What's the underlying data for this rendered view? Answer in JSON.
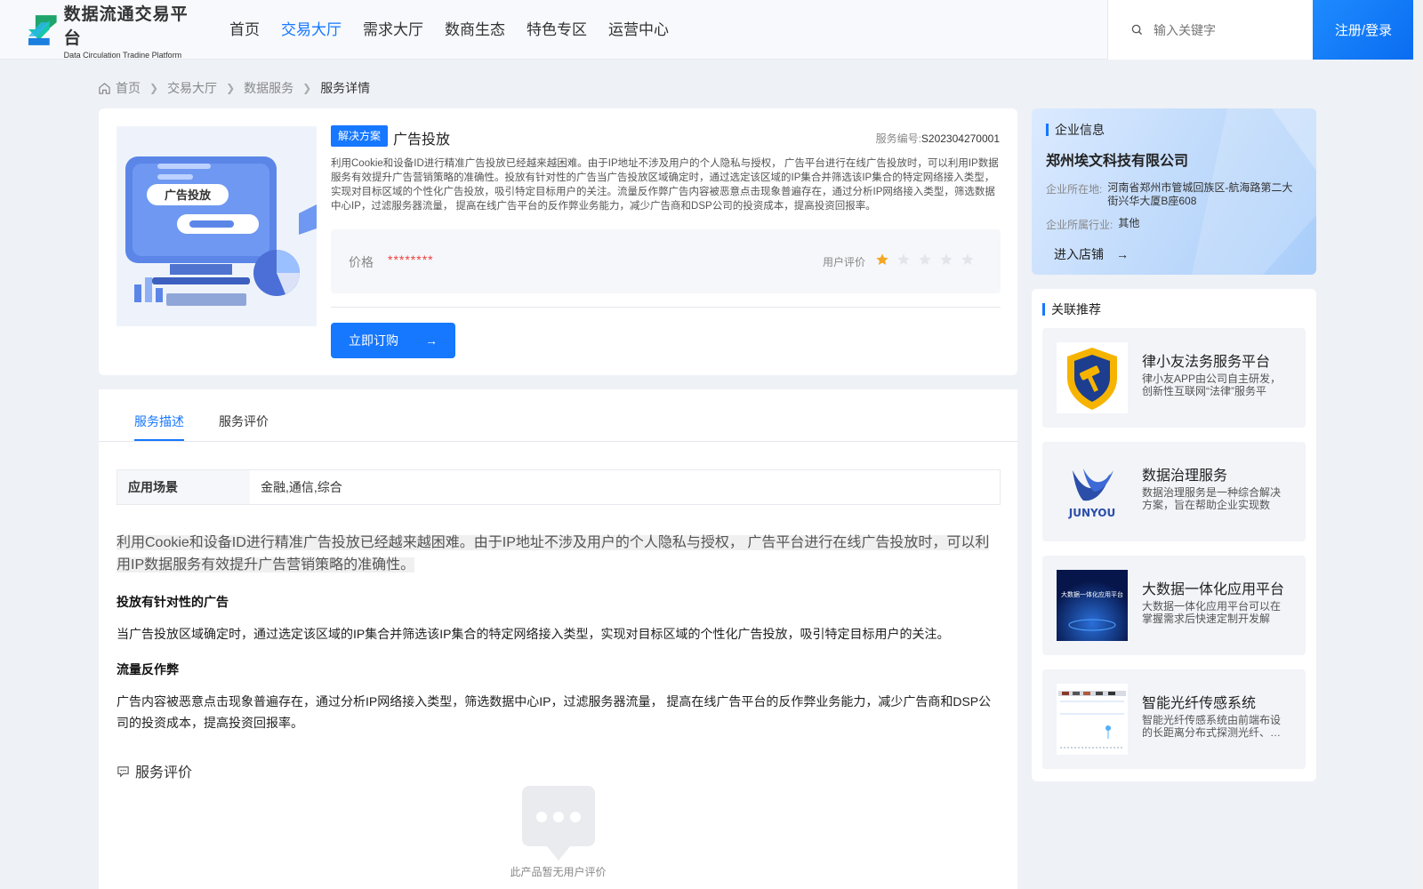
{
  "header": {
    "logo_title": "数据流通交易平台",
    "logo_subtitle": "Data Circulation Tradine Platform",
    "nav": [
      "首页",
      "交易大厅",
      "需求大厅",
      "数商生态",
      "特色专区",
      "运营中心"
    ],
    "active_nav": "交易大厅",
    "search_placeholder": "输入关键字",
    "login_label": "注册/登录"
  },
  "breadcrumb": [
    "首页",
    "交易大厅",
    "数据服务",
    "服务详情"
  ],
  "product": {
    "tag": "解决方案",
    "title": "广告投放",
    "service_no_label": "服务编号:",
    "service_no": "S202304270001",
    "image_caption": "广告投放",
    "description": "利用Cookie和设备ID进行精准广告投放已经越来越困难。由于IP地址不涉及用户的个人隐私与授权， 广告平台进行在线广告投放时，可以利用IP数据服务有效提升广告营销策略的准确性。投放有针对性的广告当广告投放区域确定时，通过选定该区域的IP集合并筛选该IP集合的特定网络接入类型，实现对目标区域的个性化广告投放，吸引特定目标用户的关注。流量反作弊广告内容被恶意点击现象普遍存在，通过分析IP网络接入类型，筛选数据中心IP，过滤服务器流量， 提高在线广告平台的反作弊业务能力，减少广告商和DSP公司的投资成本，提高投资回报率。",
    "price_label": "价格",
    "price_value": "********",
    "rating_label": "用户评价",
    "rating": 1,
    "rating_max": 5,
    "buy_label": "立即订购"
  },
  "tabs": [
    "服务描述",
    "服务评价"
  ],
  "active_tab": "服务描述",
  "detail": {
    "scene_label": "应用场景",
    "scene_value": "金融,通信,综合",
    "intro": "利用Cookie和设备ID进行精准广告投放已经越来越困难。由于IP地址不涉及用户的个人隐私与授权， 广告平台进行在线广告投放时，可以利用IP数据服务有效提升广告营销策略的准确性。",
    "section1_title": "投放有针对性的广告",
    "section1_text": "当广告投放区域确定时，通过选定该区域的IP集合并筛选该IP集合的特定网络接入类型，实现对目标区域的个性化广告投放，吸引特定目标用户的关注。",
    "section2_title": "流量反作弊",
    "section2_text": "广告内容被恶意点击现象普遍存在，通过分析IP网络接入类型，筛选数据中心IP，过滤服务器流量， 提高在线广告平台的反作弊业务能力，减少广告商和DSP公司的投资成本，提高投资回报率。",
    "review_title": "服务评价",
    "empty_review": "此产品暂无用户评价"
  },
  "company": {
    "section_title": "企业信息",
    "name": "郑州埃文科技有限公司",
    "location_label": "企业所在地:",
    "location": "河南省郑州市管城回族区-航海路第二大街兴华大厦B座608",
    "industry_label": "企业所属行业:",
    "industry": "其他",
    "shop_label": "进入店铺"
  },
  "recommend": {
    "section_title": "关联推荐",
    "items": [
      {
        "title": "律小友法务服务平台",
        "desc": "律小友APP由公司自主研发，创新性互联网“法律”服务平台…",
        "thumb_text": ""
      },
      {
        "title": "数据治理服务",
        "desc": "数据治理服务是一种综合解决方案，旨在帮助企业实现数据…",
        "thumb_text": "JUNYOU"
      },
      {
        "title": "大数据一体化应用平台",
        "desc": "大数据一体化应用平台可以在掌握需求后快速定制开发解决…",
        "thumb_text": "大数据一体化应用平台"
      },
      {
        "title": "智能光纤传感系统",
        "desc": "智能光纤传感系统由前端布设的长距离分布式探测光纤、…",
        "thumb_text": ""
      }
    ]
  },
  "colors": {
    "accent": "#1677ff",
    "price": "#f04040",
    "star_on": "#f5a623",
    "star_off": "#e3e5ea"
  }
}
